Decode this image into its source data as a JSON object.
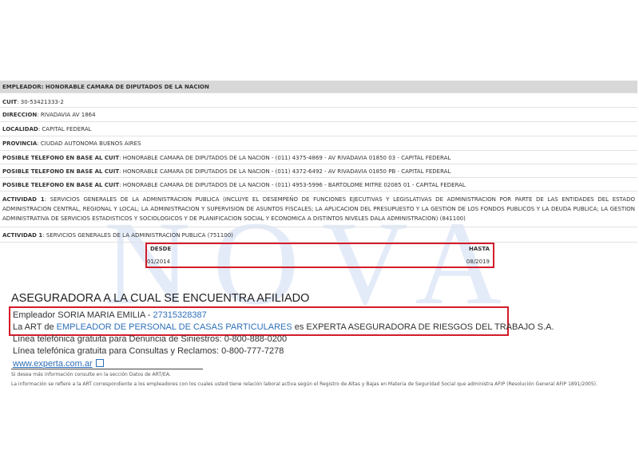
{
  "watermark": "NOVA",
  "employer": {
    "header": "EMPLEADOR: HONORABLE CAMARA DE DIPUTADOS DE LA NACION",
    "cuit_label": "CUIT",
    "cuit": "30-53421333-2",
    "direccion_label": "DIRECCION",
    "direccion": "RIVADAVIA AV 1864",
    "localidad_label": "LOCALIDAD",
    "localidad": "CAPITAL FEDERAL",
    "provincia_label": "PROVINCIA",
    "provincia": "CIUDAD AUTONOMA BUENOS AIRES",
    "phone_label": "POSIBLE TELEFONO EN BASE AL CUIT",
    "phones": [
      "HONORABLE CAMARA DE DIPUTADOS DE LA NACION - (011) 4375-4869 - AV RIVADAVIA 01850 03 - CAPITAL FEDERAL",
      "HONORABLE CAMARA DE DIPUTADOS DE LA NACION - (011) 4372-6492 - AV RIVADAVIA 01850 PB - CAPITAL FEDERAL",
      "HONORABLE CAMARA DE DIPUTADOS DE LA NACION - (011) 4953-5996 - BARTOLOME MITRE 02085 01 - CAPITAL FEDERAL"
    ],
    "actividad_label": "ACTIVIDAD 1",
    "actividad_1": "SERVICIOS GENERALES DE LA ADMINISTRACION PUBLICA (INCLUYE EL DESEMPEÑO DE FUNCIONES EJECUTIVAS Y LEGISLATIVAS DE ADMINISTRACION POR PARTE DE LAS ENTIDADES DEL ESTADO ADMINISTRACION CENTRAL, REGIONAL Y LOCAL; LA ADMINISTRACION Y SUPERVISION DE ASUNTOS FISCALES; LA APLICACION DEL PRESUPUESTO Y LA GESTION DE LOS FONDOS PUBLICOS Y LA DEUDA PUBLICA; LA GESTION ADMINISTRATIVA DE SERVICIOS ESTADISTICOS Y SOCIOLOGICOS Y DE PLANIFICACION SOCIAL Y ECONOMICA A DISTINTOS NIVELES DALA ADMINISTRACION) (841100)",
    "actividad_2": "SERVICIOS GENERALES DE LA ADMINISTRACION PUBLICA (751100)",
    "desde_label": "DESDE",
    "hasta_label": "HASTA",
    "desde": "01/2014",
    "hasta": "08/2019"
  },
  "art": {
    "title": "ASEGURADORA A LA CUAL SE ENCUENTRA AFILIADO",
    "empleador_prefix": "Empleador SORIA MARIA EMILIA - ",
    "empleador_cuit": "27315328387",
    "art_prefix": "La ART de ",
    "art_link": "EMPLEADOR DE PERSONAL DE CASAS PARTICULARES",
    "art_suffix": " es EXPERTA ASEGURADORA DE RIESGOS DEL TRABAJO S.A.",
    "line_siniestros": "Línea telefónica gratuita para Denuncia de Siniestros: 0-800-888-0200",
    "line_consultas": "Línea telefónica gratuita para Consultas y Reclamos: 0-800-777-7278",
    "website": "www.experta.com.ar",
    "note_1": "Si desea más información consulte en la sección Datos de ART/EA.",
    "note_2": "La información se refiere a la ART correspondiente a los empleadores con los cuales usted tiene relación laboral activa según el Registro de Altas y Bajas en Materia de Seguridad Social que administra AFIP (Resolución General AFIP 1891/2005)."
  }
}
